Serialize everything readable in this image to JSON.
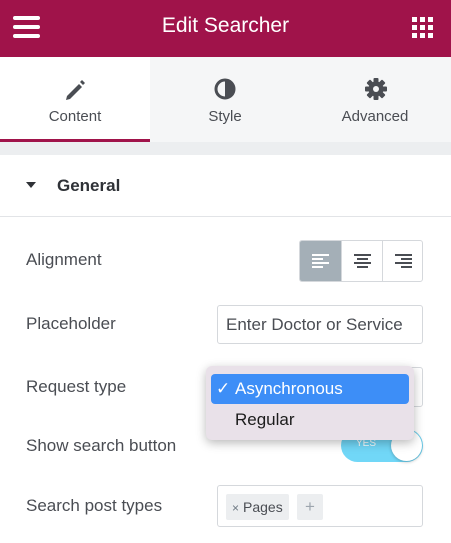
{
  "header": {
    "title": "Edit Searcher",
    "menu_icon": "hamburger-icon",
    "grid_icon": "apps-grid-icon",
    "bg_color": "#a0134a"
  },
  "tabs": [
    {
      "label": "Content",
      "icon": "pencil-icon",
      "active": true
    },
    {
      "label": "Style",
      "icon": "half-circle-icon",
      "active": false
    },
    {
      "label": "Advanced",
      "icon": "gear-icon",
      "active": false
    }
  ],
  "section": {
    "title": "General",
    "expanded": true
  },
  "controls": {
    "alignment": {
      "label": "Alignment",
      "options": [
        "left",
        "center",
        "right"
      ],
      "selected": "left"
    },
    "placeholder": {
      "label": "Placeholder",
      "value": "Enter Doctor or Service"
    },
    "request_type": {
      "label": "Request type",
      "options": [
        "Asynchronous",
        "Regular"
      ],
      "selected": "Asynchronous",
      "check": "✓"
    },
    "show_search_button": {
      "label": "Show search button",
      "state_label": "YES",
      "on": true
    },
    "search_post_types": {
      "label": "Search post types",
      "tags": [
        "Pages"
      ],
      "remove_glyph": "×",
      "add_glyph": "+"
    }
  },
  "colors": {
    "accent": "#a0134a",
    "toggle_on": "#71d7f7",
    "dropdown_highlight": "#3d8ef7"
  }
}
